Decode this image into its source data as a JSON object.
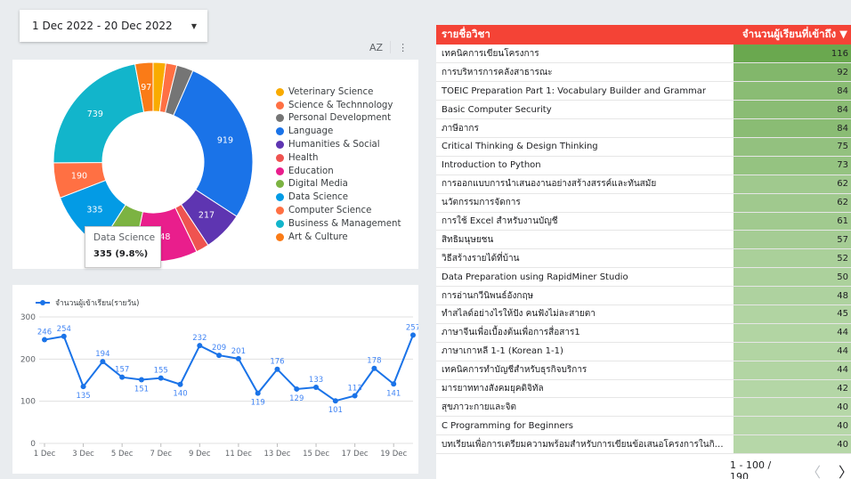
{
  "date_range": {
    "label": "1 Dec 2022 - 20 Dec 2022"
  },
  "donut_chart": {
    "tools": {
      "sort_label": "AZ",
      "menu_label": "⋮"
    },
    "tooltip": {
      "category": "Data Science",
      "value_text": "335 (9.8%)"
    }
  },
  "line_chart": {
    "legend_label": "จำนวนผู้เข้าเรียน(รายวัน)"
  },
  "chart_data": [
    {
      "type": "pie",
      "donut": true,
      "slices": [
        {
          "label": "Veterinary Science",
          "value": 68,
          "color": "#f9ab00",
          "data_label": ""
        },
        {
          "label": "Science & Technnology",
          "value": 60,
          "color": "#ff7043",
          "data_label": ""
        },
        {
          "label": "Personal Development",
          "value": 90,
          "color": "#757575",
          "data_label": ""
        },
        {
          "label": "Language",
          "value": 919,
          "color": "#1a73e8",
          "data_label": "919"
        },
        {
          "label": "Humanities & Social",
          "value": 217,
          "color": "#5e35b1",
          "data_label": "217"
        },
        {
          "label": "Health",
          "value": 70,
          "color": "#ef5350",
          "data_label": ""
        },
        {
          "label": "Education",
          "value": 348,
          "color": "#e91e8c",
          "data_label": "348"
        },
        {
          "label": "Digital Media",
          "value": 194,
          "color": "#7cb342",
          "data_label": "194"
        },
        {
          "label": "Data Science",
          "value": 335,
          "color": "#039be5",
          "data_label": "335"
        },
        {
          "label": "Computer Science",
          "value": 190,
          "color": "#ff7043",
          "data_label": "190"
        },
        {
          "label": "Business & Management",
          "value": 739,
          "color": "#12b5cb",
          "data_label": "739"
        },
        {
          "label": "Art & Culture",
          "value": 97,
          "color": "#fa7b17",
          "data_label": "97"
        }
      ]
    },
    {
      "type": "line",
      "series": [
        {
          "name": "จำนวนผู้เข้าเรียน(รายวัน)",
          "color": "#1a73e8",
          "values": [
            246,
            254,
            135,
            194,
            157,
            151,
            155,
            140,
            232,
            209,
            201,
            119,
            176,
            129,
            133,
            101,
            113,
            178,
            141,
            257
          ]
        }
      ],
      "x": [
        "1 Dec",
        "2 Dec",
        "3 Dec",
        "4 Dec",
        "5 Dec",
        "6 Dec",
        "7 Dec",
        "8 Dec",
        "9 Dec",
        "10 Dec",
        "11 Dec",
        "12 Dec",
        "13 Dec",
        "14 Dec",
        "15 Dec",
        "16 Dec",
        "17 Dec",
        "18 Dec",
        "19 Dec",
        "20 Dec"
      ],
      "xtick_labels": [
        "1 Dec",
        "3 Dec",
        "5 Dec",
        "7 Dec",
        "9 Dec",
        "11 Dec",
        "13 Dec",
        "15 Dec",
        "17 Dec",
        "19 Dec"
      ],
      "yticks": [
        0,
        100,
        200,
        300
      ],
      "ylim": [
        0,
        300
      ],
      "grid": true
    }
  ],
  "table": {
    "columns": [
      "รายชื่อวิชา",
      "จำนวนผู้เรียนที่เข้าถึง ▼"
    ],
    "max_value": 116,
    "bar_colors": {
      "high": "#6aa84f",
      "low": "#b6d7a8"
    },
    "rows": [
      {
        "name": "เทคนิคการเขียนโครงการ",
        "value": 116
      },
      {
        "name": "การบริหารการคลังสาธารณะ",
        "value": 92
      },
      {
        "name": "TOEIC Preparation Part 1: Vocabulary Builder and Grammar",
        "value": 84
      },
      {
        "name": "Basic Computer Security",
        "value": 84
      },
      {
        "name": "ภาษีอากร",
        "value": 84
      },
      {
        "name": "Critical Thinking & Design Thinking",
        "value": 75
      },
      {
        "name": "Introduction to Python",
        "value": 73
      },
      {
        "name": "การออกแบบการนำเสนองานอย่างสร้างสรรค์และทันสมัย",
        "value": 62
      },
      {
        "name": "นวัตกรรมการจัดการ",
        "value": 62
      },
      {
        "name": "การใช้ Excel สำหรับงานบัญชี",
        "value": 61
      },
      {
        "name": "สิทธิมนุษยชน",
        "value": 57
      },
      {
        "name": "วิธีสร้างรายได้ที่บ้าน",
        "value": 52
      },
      {
        "name": "Data Preparation using RapidMiner Studio",
        "value": 50
      },
      {
        "name": "การอ่านกวีนิพนธ์อังกฤษ",
        "value": 48
      },
      {
        "name": "ทำสไลด์อย่างไรให้ปัง คนฟังไม่ละสายตา",
        "value": 45
      },
      {
        "name": "ภาษาจีนเพื่อเบื้องต้นเพื่อการสื่อสาร1",
        "value": 44
      },
      {
        "name": "ภาษาเกาหลี 1-1 (Korean 1-1)",
        "value": 44
      },
      {
        "name": "เทคนิคการทำบัญชีสำหรับธุรกิจบริการ",
        "value": 44
      },
      {
        "name": "มารยาททางสังคมยุคดิจิทัล",
        "value": 42
      },
      {
        "name": "สุขภาวะกายและจิต",
        "value": 40
      },
      {
        "name": "C Programming for Beginners",
        "value": 40
      },
      {
        "name": "บทเรียนเพื่อการเตรียมความพร้อมสำหรับการเขียนข้อเสนอโครงการในกิจกรรม ...",
        "value": 40
      }
    ],
    "pagination": {
      "range": "1 - 100 / 190",
      "prev": "〈",
      "next": "〉"
    }
  }
}
